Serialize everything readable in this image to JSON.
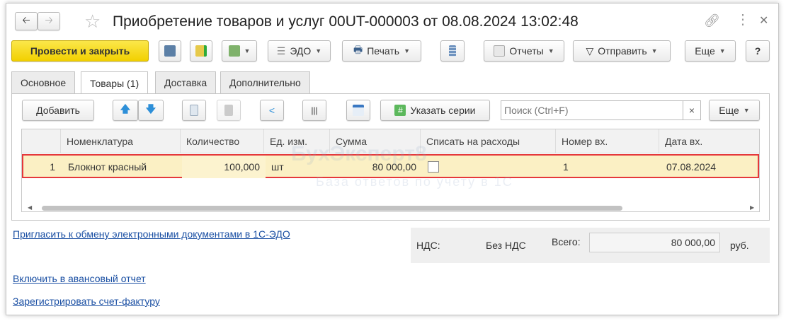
{
  "title": "Приобретение товаров и услуг 00UT-000003 от 08.08.2024 13:02:48",
  "toolbar": {
    "post_close": "Провести и закрыть",
    "edo": "ЭДО",
    "print": "Печать",
    "reports": "Отчеты",
    "send": "Отправить",
    "more": "Еще",
    "help": "?"
  },
  "tabs": [
    "Основное",
    "Товары (1)",
    "Доставка",
    "Дополнительно"
  ],
  "table_toolbar": {
    "add": "Добавить",
    "series": "Указать серии",
    "search_placeholder": "Поиск (Ctrl+F)",
    "clear": "×",
    "more": "Еще"
  },
  "table": {
    "headers": [
      "Номенклатура",
      "Количество",
      "Ед. изм.",
      "Сумма",
      "Списать на расходы",
      "Номер вх.",
      "Дата вх."
    ],
    "rows": [
      {
        "n": "1",
        "item": "Блокнот красный",
        "qty": "100,000",
        "unit": "шт",
        "sum": "80 000,00",
        "writeoff": false,
        "in_no": "1",
        "in_date": "07.08.2024"
      }
    ]
  },
  "watermark": {
    "brand": "БухЭксперт8",
    "tagline": "База ответов по учету в 1С"
  },
  "links": {
    "edo": "Пригласить  к обмену электронными документами в 1С-ЭДО",
    "advance": "Включить в авансовый отчет",
    "invoice": "Зарегистрировать счет-фактуру"
  },
  "totals": {
    "vat_label": "НДС:",
    "vat_value": "Без НДС",
    "total_label": "Всего:",
    "total_value": "80 000,00",
    "currency": "руб."
  },
  "colors": {
    "accent": "#f5d800",
    "highlight_row": "#fbf0c4",
    "selection_border": "#e5383b"
  }
}
